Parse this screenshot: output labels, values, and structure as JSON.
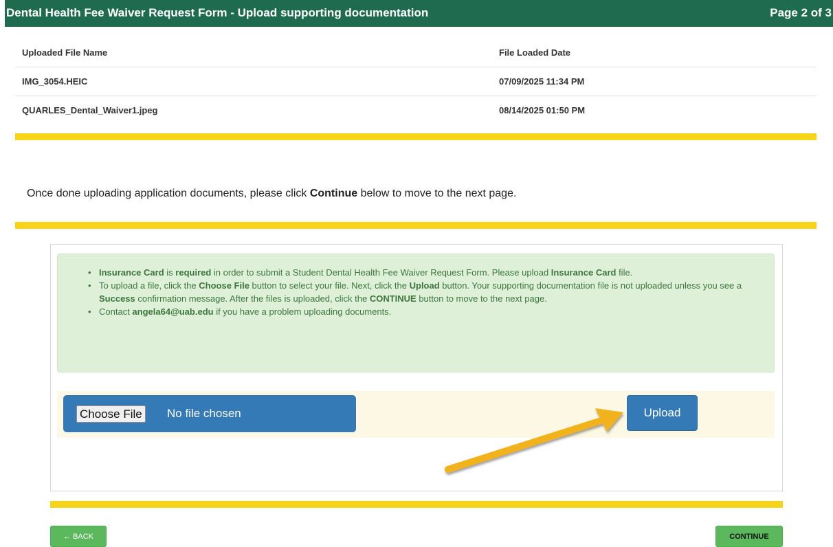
{
  "header": {
    "title": "Dental Health Fee Waiver Request Form - Upload supporting documentation",
    "page_indicator": "Page 2 of 3"
  },
  "files_table": {
    "columns": [
      "Uploaded File Name",
      "File Loaded Date"
    ],
    "rows": [
      [
        "IMG_3054.HEIC",
        "07/09/2025 11:34 PM"
      ],
      [
        "QUARLES_Dental_Waiver1.jpeg",
        "08/14/2025 01:50 PM"
      ]
    ]
  },
  "instruction": {
    "before": "Once done uploading application documents, please click ",
    "bold": "Continue",
    "after": " below to move to the next page."
  },
  "alert": {
    "item1": {
      "b1": "Insurance Card",
      "t1": " is ",
      "b2": "required",
      "t2": " in order to submit a Student Dental Health Fee Waiver Request Form. Please upload ",
      "b3": "Insurance Card",
      "t3": " file."
    },
    "item2": {
      "t1": "To upload a file, click the ",
      "b1": "Choose File",
      "t2": " button to select your file. Next, click the ",
      "b2": "Upload",
      "t3": " button. Your supporting documentation file is not uploaded unless you see a ",
      "b3": "Success",
      "t4": " confirmation message. After the files is uploaded, click the ",
      "b4": "CONTINUE",
      "t5": " button to move to the next page."
    },
    "item3": {
      "t1": "Contact ",
      "b1": "angela64@uab.edu",
      "t2": " if you have a problem uploading documents."
    }
  },
  "upload": {
    "choose_file_label": "Choose File",
    "no_file_text": "No file chosen",
    "upload_label": "Upload"
  },
  "nav": {
    "back_label": "← BACK",
    "continue_label": "CONTINUE"
  },
  "colors": {
    "header_green": "#1e6b4f",
    "divider_yellow": "#f7d417",
    "alert_bg": "#dff0d8",
    "alert_text": "#3c763d",
    "primary_blue": "#337ab7",
    "success_green": "#5cb85c",
    "arrow_orange": "#f2b21b"
  },
  "icons": {
    "annotation": "arrow-pointing-to-upload-icon"
  }
}
